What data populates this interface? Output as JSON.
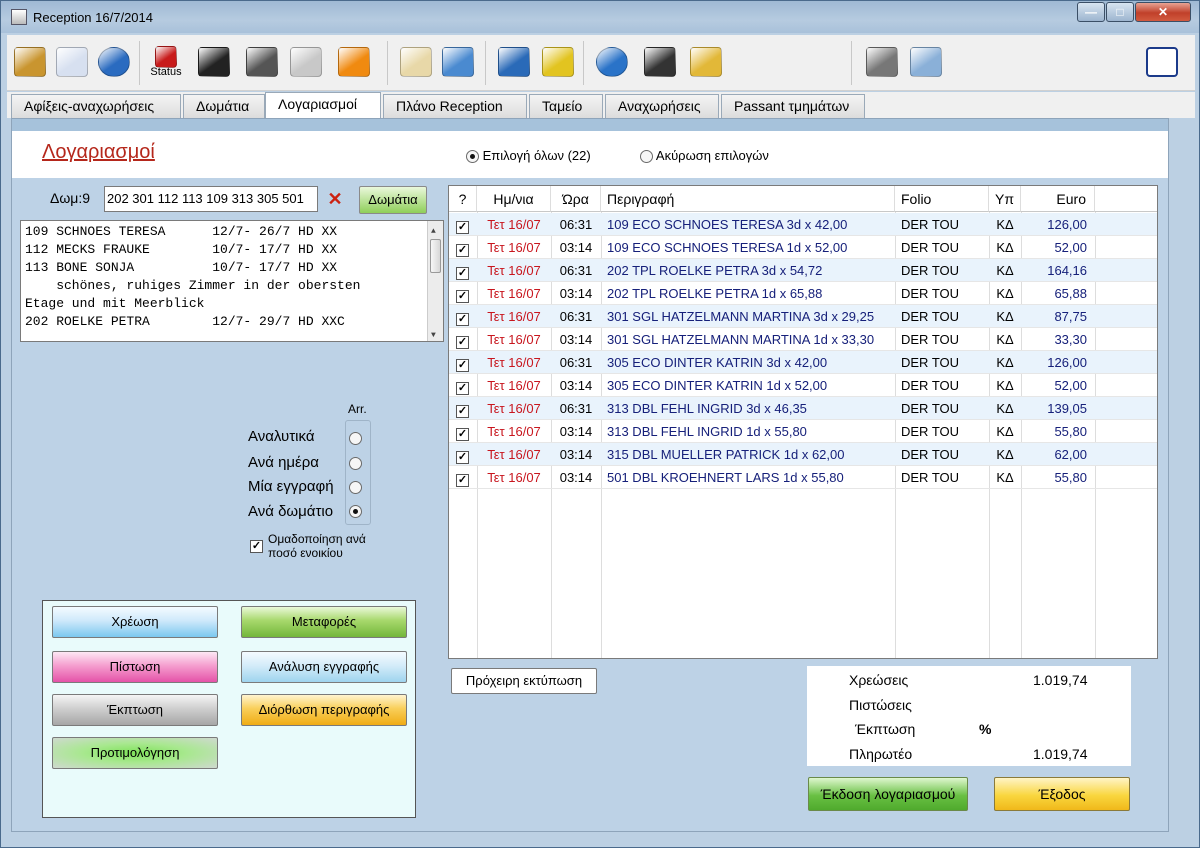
{
  "window": {
    "title": "Reception 16/7/2014"
  },
  "toolbar": {
    "items": [
      {
        "icon": "address-book-icon",
        "color": "#c9952f"
      },
      {
        "icon": "calendar-icon",
        "color": "#d7e0f0"
      },
      {
        "icon": "globe-icon",
        "color": "#2a6bc0"
      },
      {
        "icon": "status-check-icon",
        "label": "Status",
        "color": "#c81b1b"
      },
      {
        "icon": "luggage-icon",
        "color": "#222222"
      },
      {
        "icon": "bed-icon",
        "color": "#555555"
      },
      {
        "icon": "documents-icon",
        "color": "#c8c8c8"
      },
      {
        "icon": "flower-icon",
        "color": "#f08a10"
      },
      {
        "icon": "folder-open-icon",
        "color": "#e8d8a8"
      },
      {
        "icon": "airplane-icon",
        "color": "#4a8ad0"
      },
      {
        "icon": "bar-chart-icon",
        "color": "#2a6ab8"
      },
      {
        "icon": "phone-icon",
        "color": "#e2c420"
      },
      {
        "icon": "compass-icon",
        "color": "#2a73c8"
      },
      {
        "icon": "magnifier-icon",
        "color": "#333333"
      },
      {
        "icon": "mail-icon",
        "color": "#e2b838"
      },
      {
        "icon": "fax-printer-icon",
        "color": "#777777"
      },
      {
        "icon": "print-preview-icon",
        "color": "#8ab0d8"
      },
      {
        "icon": "exit-door-icon",
        "color": "#1b3a8a"
      }
    ]
  },
  "tabs": [
    {
      "label": "Αφίξεις-αναχωρήσεις"
    },
    {
      "label": "Δωμάτια"
    },
    {
      "label": "Λογαριασμοί",
      "active": true
    },
    {
      "label": "Πλάνο Reception"
    },
    {
      "label": "Ταμείο"
    },
    {
      "label": "Αναχωρήσεις"
    },
    {
      "label": "Passant τμημάτων"
    }
  ],
  "page": {
    "title": "Λογαριασμοί",
    "select_all": "Επιλογή όλων (22)",
    "cancel_selection": "Ακύρωση επιλογών"
  },
  "rooms": {
    "label": "Δωμ:9",
    "value": "202 301 112 113 109 313 305 501",
    "button": "Δωμάτια"
  },
  "guest_list": [
    "109 SCHNOES TERESA      12/7- 26/7 HD XX",
    "112 MECKS FRAUKE        10/7- 17/7 HD XX",
    "113 BONE SONJA          10/7- 17/7 HD XX",
    "    schönes, ruhiges Zimmer in der obersten",
    "Etage und mit Meerblick",
    "202 ROELKE PETRA        12/7- 29/7 HD XXC"
  ],
  "view_options": {
    "header": "Arr.",
    "options": [
      {
        "label": "Αναλυτικά",
        "selected": false
      },
      {
        "label": "Ανά ημέρα",
        "selected": false
      },
      {
        "label": "Μία εγγραφή",
        "selected": false
      },
      {
        "label": "Ανά δωμάτιο",
        "selected": true
      }
    ],
    "group_line1": "Ομαδοποίηση ανά",
    "group_line2": "ποσό ενοικίου",
    "group_checked": true
  },
  "actions": {
    "charge": "Χρέωση",
    "transfers": "Μεταφορές",
    "credit": "Πίστωση",
    "entry_analysis": "Ανάλυση εγγραφής",
    "discount": "Έκπτωση",
    "fix_description": "Διόρθωση περιγραφής",
    "proforma": "Προτιμολόγηση"
  },
  "grid": {
    "columns": [
      "?",
      "Ημ/νια",
      "Ώρα",
      "Περιγραφή",
      "Folio",
      "Υπ",
      "Euro"
    ],
    "rows": [
      {
        "checked": true,
        "date": "Τετ 16/07",
        "time": "06:31",
        "desc": "109 ECO SCHNOES TERESA 3d x 42,00",
        "folio": "DER TOU",
        "yp": "ΚΔ",
        "euro": "126,00"
      },
      {
        "checked": true,
        "date": "Τετ 16/07",
        "time": "03:14",
        "desc": "109 ECO SCHNOES TERESA 1d x 52,00",
        "folio": "DER TOU",
        "yp": "ΚΔ",
        "euro": "52,00"
      },
      {
        "checked": true,
        "date": "Τετ 16/07",
        "time": "06:31",
        "desc": "202 TPL ROELKE PETRA 3d x 54,72",
        "folio": "DER TOU",
        "yp": "ΚΔ",
        "euro": "164,16"
      },
      {
        "checked": true,
        "date": "Τετ 16/07",
        "time": "03:14",
        "desc": "202 TPL ROELKE PETRA 1d x 65,88",
        "folio": "DER TOU",
        "yp": "ΚΔ",
        "euro": "65,88"
      },
      {
        "checked": true,
        "date": "Τετ 16/07",
        "time": "06:31",
        "desc": "301 SGL HATZELMANN MARTINA 3d x 29,25",
        "folio": "DER TOU",
        "yp": "ΚΔ",
        "euro": "87,75"
      },
      {
        "checked": true,
        "date": "Τετ 16/07",
        "time": "03:14",
        "desc": "301 SGL HATZELMANN MARTINA 1d x 33,30",
        "folio": "DER TOU",
        "yp": "ΚΔ",
        "euro": "33,30"
      },
      {
        "checked": true,
        "date": "Τετ 16/07",
        "time": "06:31",
        "desc": "305 ECO DINTER KATRIN 3d x 42,00",
        "folio": "DER TOU",
        "yp": "ΚΔ",
        "euro": "126,00"
      },
      {
        "checked": true,
        "date": "Τετ 16/07",
        "time": "03:14",
        "desc": "305 ECO DINTER KATRIN 1d x 52,00",
        "folio": "DER TOU",
        "yp": "ΚΔ",
        "euro": "52,00"
      },
      {
        "checked": true,
        "date": "Τετ 16/07",
        "time": "06:31",
        "desc": "313 DBL FEHL INGRID 3d x 46,35",
        "folio": "DER TOU",
        "yp": "ΚΔ",
        "euro": "139,05"
      },
      {
        "checked": true,
        "date": "Τετ 16/07",
        "time": "03:14",
        "desc": "313 DBL FEHL INGRID 1d x 55,80",
        "folio": "DER TOU",
        "yp": "ΚΔ",
        "euro": "55,80"
      },
      {
        "checked": true,
        "date": "Τετ 16/07",
        "time": "03:14",
        "desc": "315 DBL MUELLER PATRICK 1d x 62,00",
        "folio": "DER TOU",
        "yp": "ΚΔ",
        "euro": "62,00"
      },
      {
        "checked": true,
        "date": "Τετ 16/07",
        "time": "03:14",
        "desc": "501 DBL KROEHNERT LARS 1d x 55,80",
        "folio": "DER TOU",
        "yp": "ΚΔ",
        "euro": "55,80"
      }
    ]
  },
  "draft_print": "Πρόχειρη εκτύπωση",
  "totals": {
    "charges_label": "Χρεώσεις",
    "charges_value": "1.019,74",
    "credits_label": "Πιστώσεις",
    "discount_label": "Έκπτωση",
    "discount_symbol": "%",
    "payable_label": "Πληρωτέο",
    "payable_value": "1.019,74"
  },
  "footer": {
    "issue_bill": "Έκδοση λογαριασμού",
    "exit": "Έξοδος"
  },
  "colors": {
    "accent_red": "#c8161e",
    "row_blue": "#16207a",
    "selected_row": "#e9f3fc"
  }
}
